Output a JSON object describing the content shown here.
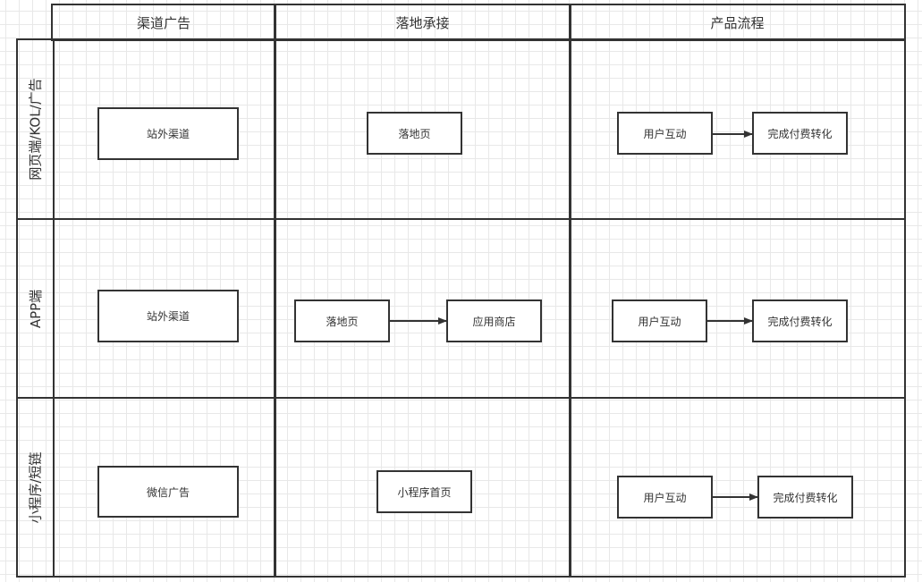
{
  "diagram": {
    "columns": [
      {
        "id": "channel",
        "label": "渠道广告"
      },
      {
        "id": "landing",
        "label": "落地承接"
      },
      {
        "id": "product",
        "label": "产品流程"
      }
    ],
    "rows": [
      {
        "id": "web",
        "label": "网页端/KOL/广告",
        "channel": [
          "站外渠道"
        ],
        "landing": [
          "落地页"
        ],
        "product": [
          "用户互动",
          "完成付费转化"
        ]
      },
      {
        "id": "app",
        "label": "APP端",
        "channel": [
          "站外渠道"
        ],
        "landing": [
          "落地页",
          "应用商店"
        ],
        "product": [
          "用户互动",
          "完成付费转化"
        ]
      },
      {
        "id": "miniprogram",
        "label": "小程序/短链",
        "channel": [
          "微信广告"
        ],
        "landing": [
          "小程序首页"
        ],
        "product": [
          "用户互动",
          "完成付费转化"
        ]
      }
    ],
    "edges": [
      {
        "row": "web",
        "from": "用户互动",
        "to": "完成付费转化"
      },
      {
        "row": "app",
        "from": "落地页",
        "to": "应用商店"
      },
      {
        "row": "app",
        "from": "用户互动",
        "to": "完成付费转化"
      },
      {
        "row": "miniprogram",
        "from": "用户互动",
        "to": "完成付费转化"
      }
    ],
    "colors": {
      "stroke": "#333333",
      "grid": "#e8e8e8",
      "background": "#ffffff"
    }
  }
}
